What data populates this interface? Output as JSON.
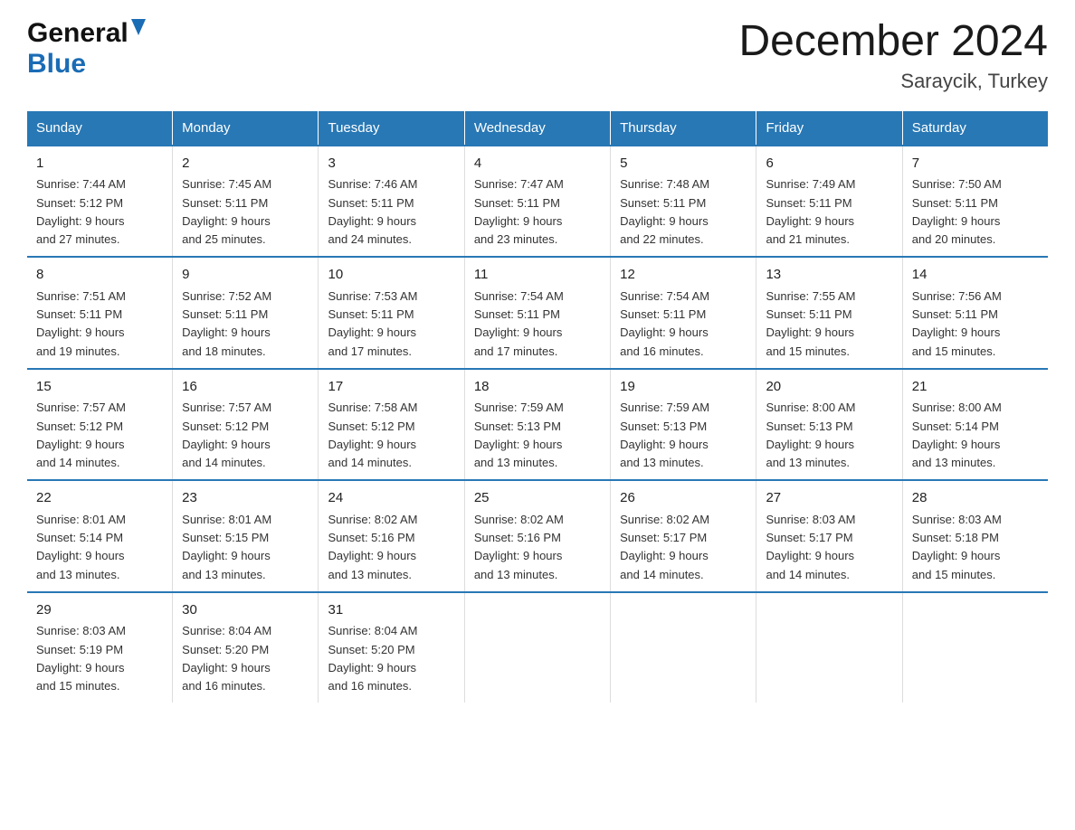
{
  "header": {
    "logo_general": "General",
    "logo_blue": "Blue",
    "title": "December 2024",
    "subtitle": "Saraycik, Turkey"
  },
  "days_of_week": [
    "Sunday",
    "Monday",
    "Tuesday",
    "Wednesday",
    "Thursday",
    "Friday",
    "Saturday"
  ],
  "weeks": [
    [
      {
        "day": "1",
        "sunrise": "7:44 AM",
        "sunset": "5:12 PM",
        "daylight": "9 hours and 27 minutes."
      },
      {
        "day": "2",
        "sunrise": "7:45 AM",
        "sunset": "5:11 PM",
        "daylight": "9 hours and 25 minutes."
      },
      {
        "day": "3",
        "sunrise": "7:46 AM",
        "sunset": "5:11 PM",
        "daylight": "9 hours and 24 minutes."
      },
      {
        "day": "4",
        "sunrise": "7:47 AM",
        "sunset": "5:11 PM",
        "daylight": "9 hours and 23 minutes."
      },
      {
        "day": "5",
        "sunrise": "7:48 AM",
        "sunset": "5:11 PM",
        "daylight": "9 hours and 22 minutes."
      },
      {
        "day": "6",
        "sunrise": "7:49 AM",
        "sunset": "5:11 PM",
        "daylight": "9 hours and 21 minutes."
      },
      {
        "day": "7",
        "sunrise": "7:50 AM",
        "sunset": "5:11 PM",
        "daylight": "9 hours and 20 minutes."
      }
    ],
    [
      {
        "day": "8",
        "sunrise": "7:51 AM",
        "sunset": "5:11 PM",
        "daylight": "9 hours and 19 minutes."
      },
      {
        "day": "9",
        "sunrise": "7:52 AM",
        "sunset": "5:11 PM",
        "daylight": "9 hours and 18 minutes."
      },
      {
        "day": "10",
        "sunrise": "7:53 AM",
        "sunset": "5:11 PM",
        "daylight": "9 hours and 17 minutes."
      },
      {
        "day": "11",
        "sunrise": "7:54 AM",
        "sunset": "5:11 PM",
        "daylight": "9 hours and 17 minutes."
      },
      {
        "day": "12",
        "sunrise": "7:54 AM",
        "sunset": "5:11 PM",
        "daylight": "9 hours and 16 minutes."
      },
      {
        "day": "13",
        "sunrise": "7:55 AM",
        "sunset": "5:11 PM",
        "daylight": "9 hours and 15 minutes."
      },
      {
        "day": "14",
        "sunrise": "7:56 AM",
        "sunset": "5:11 PM",
        "daylight": "9 hours and 15 minutes."
      }
    ],
    [
      {
        "day": "15",
        "sunrise": "7:57 AM",
        "sunset": "5:12 PM",
        "daylight": "9 hours and 14 minutes."
      },
      {
        "day": "16",
        "sunrise": "7:57 AM",
        "sunset": "5:12 PM",
        "daylight": "9 hours and 14 minutes."
      },
      {
        "day": "17",
        "sunrise": "7:58 AM",
        "sunset": "5:12 PM",
        "daylight": "9 hours and 14 minutes."
      },
      {
        "day": "18",
        "sunrise": "7:59 AM",
        "sunset": "5:13 PM",
        "daylight": "9 hours and 13 minutes."
      },
      {
        "day": "19",
        "sunrise": "7:59 AM",
        "sunset": "5:13 PM",
        "daylight": "9 hours and 13 minutes."
      },
      {
        "day": "20",
        "sunrise": "8:00 AM",
        "sunset": "5:13 PM",
        "daylight": "9 hours and 13 minutes."
      },
      {
        "day": "21",
        "sunrise": "8:00 AM",
        "sunset": "5:14 PM",
        "daylight": "9 hours and 13 minutes."
      }
    ],
    [
      {
        "day": "22",
        "sunrise": "8:01 AM",
        "sunset": "5:14 PM",
        "daylight": "9 hours and 13 minutes."
      },
      {
        "day": "23",
        "sunrise": "8:01 AM",
        "sunset": "5:15 PM",
        "daylight": "9 hours and 13 minutes."
      },
      {
        "day": "24",
        "sunrise": "8:02 AM",
        "sunset": "5:16 PM",
        "daylight": "9 hours and 13 minutes."
      },
      {
        "day": "25",
        "sunrise": "8:02 AM",
        "sunset": "5:16 PM",
        "daylight": "9 hours and 13 minutes."
      },
      {
        "day": "26",
        "sunrise": "8:02 AM",
        "sunset": "5:17 PM",
        "daylight": "9 hours and 14 minutes."
      },
      {
        "day": "27",
        "sunrise": "8:03 AM",
        "sunset": "5:17 PM",
        "daylight": "9 hours and 14 minutes."
      },
      {
        "day": "28",
        "sunrise": "8:03 AM",
        "sunset": "5:18 PM",
        "daylight": "9 hours and 15 minutes."
      }
    ],
    [
      {
        "day": "29",
        "sunrise": "8:03 AM",
        "sunset": "5:19 PM",
        "daylight": "9 hours and 15 minutes."
      },
      {
        "day": "30",
        "sunrise": "8:04 AM",
        "sunset": "5:20 PM",
        "daylight": "9 hours and 16 minutes."
      },
      {
        "day": "31",
        "sunrise": "8:04 AM",
        "sunset": "5:20 PM",
        "daylight": "9 hours and 16 minutes."
      },
      null,
      null,
      null,
      null
    ]
  ],
  "labels": {
    "sunrise": "Sunrise:",
    "sunset": "Sunset:",
    "daylight": "Daylight:"
  }
}
